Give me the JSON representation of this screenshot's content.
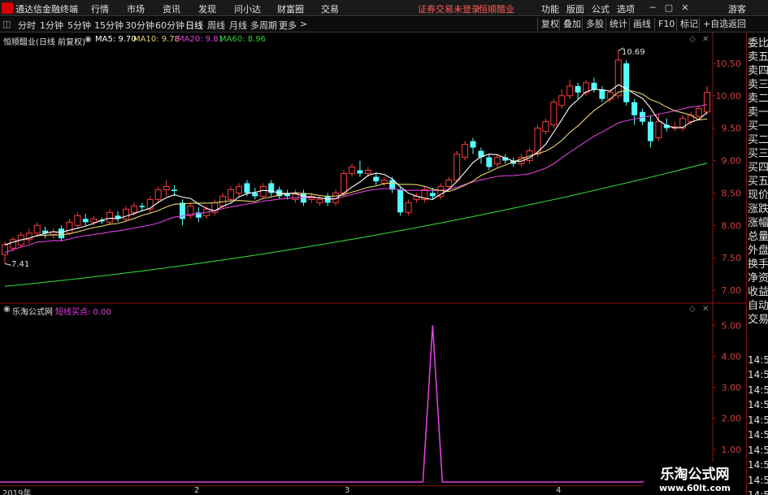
{
  "menu": {
    "app_title": "通达信金融终端",
    "items": [
      "行情",
      "市场",
      "资讯",
      "发现",
      "问小达",
      "财富圈",
      "交易"
    ],
    "notice": "证券交易未登录",
    "stock": "恒顺醋业",
    "right_items": [
      "功能",
      "版面",
      "公式",
      "选项"
    ],
    "user": "游客"
  },
  "toolbar": {
    "periods": [
      "分时",
      "1分钟",
      "5分钟",
      "15分钟",
      "30分钟",
      "60分钟",
      "日线",
      "周线",
      "月线",
      "多周期",
      "更多"
    ],
    "active_period": "日线",
    "right_buttons": [
      "复权",
      "叠加",
      "多股",
      "统计",
      "画线",
      "F10",
      "标记",
      "+自选",
      "返回"
    ]
  },
  "main_chart": {
    "title": "恒顺醋业(日线 前复权)",
    "indicators": [
      {
        "label": "MA5: 9.70",
        "color": "#ffffff"
      },
      {
        "label": "MA10: 9.78",
        "color": "#e8d36a"
      },
      {
        "label": "MA20: 9.81",
        "color": "#e040e0"
      },
      {
        "label": "MA60: 8.96",
        "color": "#30d030"
      }
    ],
    "high_label": "10.69",
    "low_label": "7.41",
    "y_ticks": [
      "10.50",
      "10.00",
      "9.50",
      "9.00",
      "8.50",
      "8.00",
      "7.50",
      "7.00"
    ]
  },
  "sub_chart": {
    "title": "乐淘公式网",
    "indicator": "短线买点: 0.00",
    "y_ticks": [
      "5.00",
      "4.00",
      "3.00",
      "2.00",
      "1.00"
    ]
  },
  "x_labels": [
    "2019年",
    "2",
    "3",
    "4"
  ],
  "right_panel": [
    "委比",
    "卖五",
    "卖四",
    "卖三",
    "卖二",
    "卖一",
    "买一",
    "买二",
    "买三",
    "买四",
    "买五",
    "现价",
    "涨跌",
    "涨幅",
    "总量",
    "外盘",
    "换手",
    "净资",
    "收益",
    "自动",
    "交易",
    "14:56",
    "14:56",
    "14:56",
    "14:56",
    "14:56",
    "14:56",
    "14:56",
    "14:56",
    "14:56",
    "14:56"
  ],
  "watermark": {
    "title": "乐淘公式网",
    "url": "www.60lt.com"
  },
  "chart_data": [
    {
      "type": "candlestick",
      "title": "恒顺醋业(日线 前复权)",
      "ylim": [
        6.9,
        10.8
      ],
      "x_labels": [
        "2019年",
        "2",
        "3",
        "4"
      ],
      "candles": [
        {
          "o": 7.55,
          "c": 7.7,
          "h": 7.75,
          "l": 7.41
        },
        {
          "o": 7.65,
          "c": 7.78,
          "h": 7.82,
          "l": 7.6
        },
        {
          "o": 7.7,
          "c": 7.85,
          "h": 7.9,
          "l": 7.65
        },
        {
          "o": 7.78,
          "c": 7.88,
          "h": 7.95,
          "l": 7.72
        },
        {
          "o": 7.88,
          "c": 8.0,
          "h": 8.05,
          "l": 7.82
        },
        {
          "o": 7.92,
          "c": 7.88,
          "h": 7.98,
          "l": 7.8
        },
        {
          "o": 7.85,
          "c": 7.9,
          "h": 7.95,
          "l": 7.8
        },
        {
          "o": 7.95,
          "c": 7.8,
          "h": 8.0,
          "l": 7.75
        },
        {
          "o": 7.88,
          "c": 8.05,
          "h": 8.1,
          "l": 7.85
        },
        {
          "o": 8.0,
          "c": 8.15,
          "h": 8.2,
          "l": 7.95
        },
        {
          "o": 8.1,
          "c": 8.05,
          "h": 8.18,
          "l": 8.0
        },
        {
          "o": 8.05,
          "c": 8.1,
          "h": 8.15,
          "l": 8.0
        },
        {
          "o": 8.08,
          "c": 8.06,
          "h": 8.12,
          "l": 8.02
        },
        {
          "o": 8.05,
          "c": 8.2,
          "h": 8.25,
          "l": 8.0
        },
        {
          "o": 8.15,
          "c": 8.1,
          "h": 8.22,
          "l": 8.05
        },
        {
          "o": 8.1,
          "c": 8.25,
          "h": 8.3,
          "l": 8.05
        },
        {
          "o": 8.2,
          "c": 8.3,
          "h": 8.35,
          "l": 8.15
        },
        {
          "o": 8.3,
          "c": 8.28,
          "h": 8.35,
          "l": 8.22
        },
        {
          "o": 8.25,
          "c": 8.4,
          "h": 8.45,
          "l": 8.2
        },
        {
          "o": 8.4,
          "c": 8.55,
          "h": 8.6,
          "l": 8.35
        },
        {
          "o": 8.55,
          "c": 8.6,
          "h": 8.7,
          "l": 8.45
        },
        {
          "o": 8.55,
          "c": 8.53,
          "h": 8.62,
          "l": 8.45
        },
        {
          "o": 8.35,
          "c": 8.1,
          "h": 8.4,
          "l": 8.0
        },
        {
          "o": 8.15,
          "c": 8.3,
          "h": 8.35,
          "l": 8.1
        },
        {
          "o": 8.2,
          "c": 8.12,
          "h": 8.28,
          "l": 8.05
        },
        {
          "o": 8.15,
          "c": 8.25,
          "h": 8.3,
          "l": 8.1
        },
        {
          "o": 8.2,
          "c": 8.35,
          "h": 8.4,
          "l": 8.15
        },
        {
          "o": 8.3,
          "c": 8.45,
          "h": 8.5,
          "l": 8.25
        },
        {
          "o": 8.4,
          "c": 8.55,
          "h": 8.6,
          "l": 8.35
        },
        {
          "o": 8.5,
          "c": 8.6,
          "h": 8.65,
          "l": 8.45
        },
        {
          "o": 8.65,
          "c": 8.5,
          "h": 8.7,
          "l": 8.45
        },
        {
          "o": 8.5,
          "c": 8.45,
          "h": 8.58,
          "l": 8.4
        },
        {
          "o": 8.45,
          "c": 8.6,
          "h": 8.65,
          "l": 8.4
        },
        {
          "o": 8.65,
          "c": 8.5,
          "h": 8.7,
          "l": 8.45
        },
        {
          "o": 8.55,
          "c": 8.45,
          "h": 8.6,
          "l": 8.4
        },
        {
          "o": 8.5,
          "c": 8.45,
          "h": 8.55,
          "l": 8.4
        },
        {
          "o": 8.4,
          "c": 8.48,
          "h": 8.55,
          "l": 8.35
        },
        {
          "o": 8.5,
          "c": 8.35,
          "h": 8.55,
          "l": 8.3
        },
        {
          "o": 8.4,
          "c": 8.45,
          "h": 8.5,
          "l": 8.35
        },
        {
          "o": 8.35,
          "c": 8.4,
          "h": 8.45,
          "l": 8.3
        },
        {
          "o": 8.45,
          "c": 8.35,
          "h": 8.5,
          "l": 8.3
        },
        {
          "o": 8.35,
          "c": 8.5,
          "h": 8.55,
          "l": 8.3
        },
        {
          "o": 8.5,
          "c": 8.8,
          "h": 8.85,
          "l": 8.45
        },
        {
          "o": 8.8,
          "c": 8.9,
          "h": 8.95,
          "l": 8.75
        },
        {
          "o": 8.85,
          "c": 8.8,
          "h": 9.0,
          "l": 8.75
        },
        {
          "o": 8.8,
          "c": 8.85,
          "h": 8.9,
          "l": 8.75
        },
        {
          "o": 8.75,
          "c": 8.68,
          "h": 8.8,
          "l": 8.62
        },
        {
          "o": 8.65,
          "c": 8.7,
          "h": 8.75,
          "l": 8.6
        },
        {
          "o": 8.7,
          "c": 8.55,
          "h": 8.75,
          "l": 8.5
        },
        {
          "o": 8.55,
          "c": 8.2,
          "h": 8.6,
          "l": 8.15
        },
        {
          "o": 8.2,
          "c": 8.35,
          "h": 8.4,
          "l": 8.15
        },
        {
          "o": 8.4,
          "c": 8.45,
          "h": 8.5,
          "l": 8.35
        },
        {
          "o": 8.4,
          "c": 8.55,
          "h": 8.6,
          "l": 8.35
        },
        {
          "o": 8.5,
          "c": 8.45,
          "h": 8.58,
          "l": 8.4
        },
        {
          "o": 8.45,
          "c": 8.6,
          "h": 8.65,
          "l": 8.4
        },
        {
          "o": 8.6,
          "c": 8.7,
          "h": 8.75,
          "l": 8.55
        },
        {
          "o": 8.7,
          "c": 9.1,
          "h": 9.15,
          "l": 8.65
        },
        {
          "o": 9.05,
          "c": 9.25,
          "h": 9.3,
          "l": 9.0
        },
        {
          "o": 9.3,
          "c": 9.2,
          "h": 9.35,
          "l": 9.1
        },
        {
          "o": 9.15,
          "c": 9.05,
          "h": 9.2,
          "l": 8.95
        },
        {
          "o": 9.05,
          "c": 8.9,
          "h": 9.1,
          "l": 8.85
        },
        {
          "o": 8.95,
          "c": 9.05,
          "h": 9.1,
          "l": 8.9
        },
        {
          "o": 9.05,
          "c": 9.0,
          "h": 9.1,
          "l": 8.95
        },
        {
          "o": 9.0,
          "c": 8.95,
          "h": 9.05,
          "l": 8.9
        },
        {
          "o": 8.95,
          "c": 9.05,
          "h": 9.1,
          "l": 8.9
        },
        {
          "o": 9.0,
          "c": 9.15,
          "h": 9.2,
          "l": 8.95
        },
        {
          "o": 9.1,
          "c": 9.5,
          "h": 9.55,
          "l": 9.05
        },
        {
          "o": 9.45,
          "c": 9.6,
          "h": 9.65,
          "l": 9.4
        },
        {
          "o": 9.55,
          "c": 9.9,
          "h": 9.95,
          "l": 9.5
        },
        {
          "o": 9.85,
          "c": 10.0,
          "h": 10.1,
          "l": 9.8
        },
        {
          "o": 10.0,
          "c": 10.15,
          "h": 10.25,
          "l": 9.95
        },
        {
          "o": 10.15,
          "c": 10.05,
          "h": 10.2,
          "l": 9.95
        },
        {
          "o": 10.05,
          "c": 10.2,
          "h": 10.25,
          "l": 10.0
        },
        {
          "o": 10.2,
          "c": 10.1,
          "h": 10.28,
          "l": 10.05
        },
        {
          "o": 10.1,
          "c": 9.95,
          "h": 10.15,
          "l": 9.9
        },
        {
          "o": 9.95,
          "c": 10.05,
          "h": 10.1,
          "l": 9.9
        },
        {
          "o": 10.0,
          "c": 10.55,
          "h": 10.69,
          "l": 9.95
        },
        {
          "o": 10.5,
          "c": 9.9,
          "h": 10.55,
          "l": 9.85
        },
        {
          "o": 9.9,
          "c": 9.7,
          "h": 9.95,
          "l": 9.55
        },
        {
          "o": 9.75,
          "c": 9.6,
          "h": 9.8,
          "l": 9.55
        },
        {
          "o": 9.6,
          "c": 9.3,
          "h": 9.7,
          "l": 9.2
        },
        {
          "o": 9.35,
          "c": 9.6,
          "h": 9.7,
          "l": 9.3
        },
        {
          "o": 9.55,
          "c": 9.5,
          "h": 9.65,
          "l": 9.45
        },
        {
          "o": 9.5,
          "c": 9.52,
          "h": 9.6,
          "l": 9.45
        },
        {
          "o": 9.5,
          "c": 9.65,
          "h": 9.7,
          "l": 9.45
        },
        {
          "o": 9.6,
          "c": 9.7,
          "h": 9.75,
          "l": 9.55
        },
        {
          "o": 9.68,
          "c": 9.8,
          "h": 9.85,
          "l": 9.65
        },
        {
          "o": 9.75,
          "c": 10.05,
          "h": 10.15,
          "l": 9.7
        }
      ],
      "ma5_end": 9.7,
      "ma10_end": 9.78,
      "ma20_end": 9.81,
      "ma60_end": 8.96,
      "ma60_start": 7.06
    },
    {
      "type": "line",
      "title": "乐淘公式网",
      "series": [
        {
          "name": "短线买点",
          "spike_index": 53,
          "spike_value": 5.0
        }
      ],
      "ylim": [
        0,
        5.4
      ]
    }
  ]
}
